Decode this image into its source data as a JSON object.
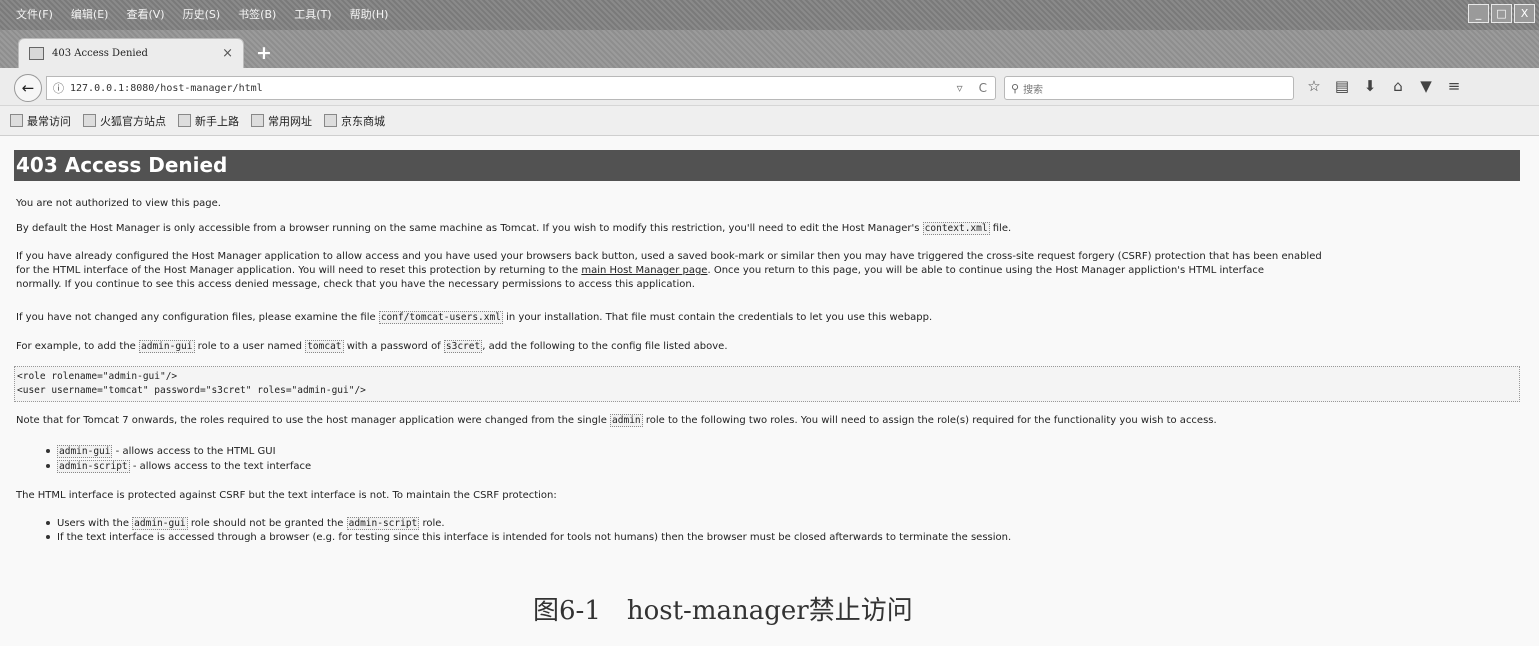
{
  "menubar": {
    "items": [
      "文件(F)",
      "编辑(E)",
      "查看(V)",
      "历史(S)",
      "书签(B)",
      "工具(T)",
      "帮助(H)"
    ],
    "window_controls": [
      "_",
      "□",
      "X"
    ]
  },
  "tab": {
    "title": "403 Access Denied",
    "close": "×",
    "new_tab": "+"
  },
  "navbar": {
    "back": "←",
    "url": "127.0.0.1:8080/host-manager/html",
    "search_placeholder": "搜索",
    "toolbar_icons": [
      "☆",
      "▤",
      "⬇",
      "⌂",
      "▼",
      "≡"
    ]
  },
  "bookmarks": [
    "最常访问",
    "火狐官方站点",
    "新手上路",
    "常用网址",
    "京东商城"
  ],
  "page": {
    "title": "403 Access Denied",
    "p1": "You are not authorized to view this page.",
    "p2_a": "By default the Host Manager is only accessible from a browser running on the same machine as Tomcat. If you wish to modify this restriction, you'll need to edit the Host Manager's ",
    "p2_code": "context.xml",
    "p2_b": " file.",
    "p3_line1": "If you have already configured the Host Manager application to allow access and you have used your browsers back button, used a saved book-mark or similar then you may have triggered the cross-site request forgery (CSRF) protection that has been enabled",
    "p3_line2_a": "for the HTML interface of the Host Manager application. You will need to reset this protection by returning to the ",
    "p3_link": "main Host Manager page",
    "p3_line2_b": ". Once you return to this page, you will be able to continue using the Host Manager appliction's HTML interface",
    "p3_line3": "normally. If you continue to see this access denied message, check that you have the necessary permissions to access this application.",
    "p4_a": "If you have not changed any configuration files, please examine the file ",
    "p4_code": "conf/tomcat-users.xml",
    "p4_b": " in your installation. That file must contain the credentials to let you use this webapp.",
    "p5_a": "For example, to add the ",
    "p5_code1": "admin-gui",
    "p5_b": " role to a user named ",
    "p5_code2": "tomcat",
    "p5_c": " with a password of ",
    "p5_code3": "s3cret",
    "p5_d": ", add the following to the config file listed above.",
    "code_line1": "<role rolename=\"admin-gui\"/>",
    "code_line2": "<user username=\"tomcat\" password=\"s3cret\" roles=\"admin-gui\"/>",
    "p6_a": "Note that for Tomcat 7 onwards, the roles required to use the host manager application were changed from the single ",
    "p6_code": "admin",
    "p6_b": " role to the following two roles. You will need to assign the role(s) required for the functionality you wish to access.",
    "li1_code": "admin-gui",
    "li1_text": " - allows access to the HTML GUI",
    "li2_code": "admin-script",
    "li2_text": " - allows access to the text interface",
    "p7": "The HTML interface is protected against CSRF but the text interface is not. To maintain the CSRF protection:",
    "li3_a": "Users with the ",
    "li3_code1": "admin-gui",
    "li3_b": " role should not be granted the ",
    "li3_code2": "admin-script",
    "li3_c": " role.",
    "li4": "If the text interface is accessed through a browser (e.g. for testing since this interface is intended for tools not humans) then the browser must be closed afterwards to terminate the session."
  },
  "caption": "图6-1　host-manager禁止访问"
}
